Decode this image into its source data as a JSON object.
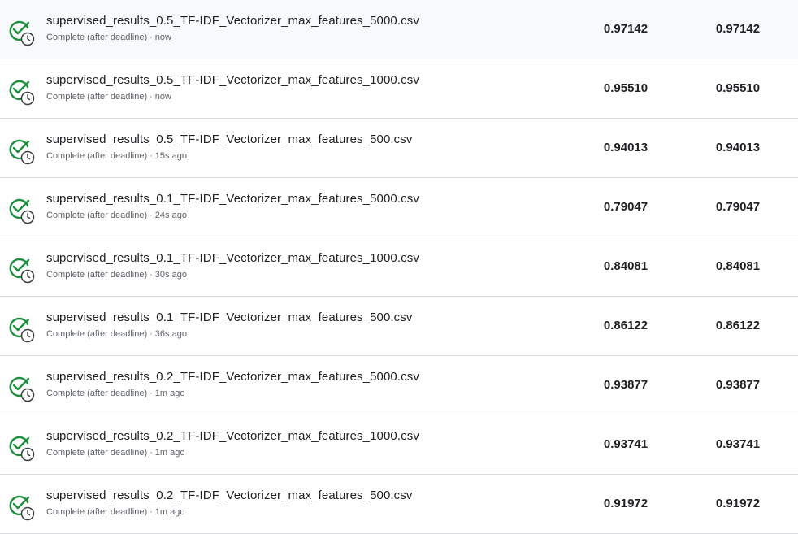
{
  "colors": {
    "check_green": "#1e8e3e",
    "clock_gray": "#3c4043",
    "divider": "#dadce0",
    "highlight_row": "#f8f9fa"
  },
  "icons": {
    "status": "check-circle-with-clock-icon"
  },
  "submissions": [
    {
      "filename": "supervised_results_0.5_TF-IDF_Vectorizer_max_features_5000.csv",
      "status": "Complete (after deadline)",
      "separator": "·",
      "time": "now",
      "private_score": "0.97142",
      "public_score": "0.97142"
    },
    {
      "filename": "supervised_results_0.5_TF-IDF_Vectorizer_max_features_1000.csv",
      "status": "Complete (after deadline)",
      "separator": "·",
      "time": "now",
      "private_score": "0.95510",
      "public_score": "0.95510"
    },
    {
      "filename": "supervised_results_0.5_TF-IDF_Vectorizer_max_features_500.csv",
      "status": "Complete (after deadline)",
      "separator": "·",
      "time": "15s ago",
      "private_score": "0.94013",
      "public_score": "0.94013"
    },
    {
      "filename": "supervised_results_0.1_TF-IDF_Vectorizer_max_features_5000.csv",
      "status": "Complete (after deadline)",
      "separator": "·",
      "time": "24s ago",
      "private_score": "0.79047",
      "public_score": "0.79047"
    },
    {
      "filename": "supervised_results_0.1_TF-IDF_Vectorizer_max_features_1000.csv",
      "status": "Complete (after deadline)",
      "separator": "·",
      "time": "30s ago",
      "private_score": "0.84081",
      "public_score": "0.84081"
    },
    {
      "filename": "supervised_results_0.1_TF-IDF_Vectorizer_max_features_500.csv",
      "status": "Complete (after deadline)",
      "separator": "·",
      "time": "36s ago",
      "private_score": "0.86122",
      "public_score": "0.86122"
    },
    {
      "filename": "supervised_results_0.2_TF-IDF_Vectorizer_max_features_5000.csv",
      "status": "Complete (after deadline)",
      "separator": "·",
      "time": "1m ago",
      "private_score": "0.93877",
      "public_score": "0.93877"
    },
    {
      "filename": "supervised_results_0.2_TF-IDF_Vectorizer_max_features_1000.csv",
      "status": "Complete (after deadline)",
      "separator": "·",
      "time": "1m ago",
      "private_score": "0.93741",
      "public_score": "0.93741"
    },
    {
      "filename": "supervised_results_0.2_TF-IDF_Vectorizer_max_features_500.csv",
      "status": "Complete (after deadline)",
      "separator": "·",
      "time": "1m ago",
      "private_score": "0.91972",
      "public_score": "0.91972"
    }
  ]
}
